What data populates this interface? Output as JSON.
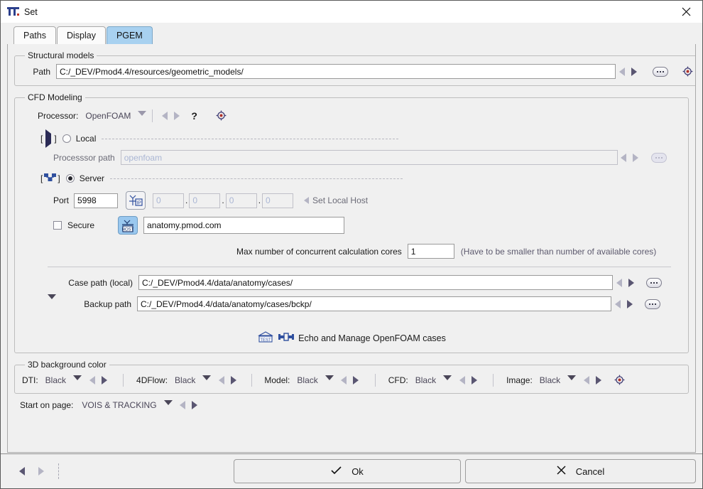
{
  "window": {
    "title": "Set",
    "app_icon": "pmod-logo-icon",
    "close_icon": "close-icon"
  },
  "tabs": [
    {
      "label": "Paths",
      "active": false
    },
    {
      "label": "Display",
      "active": false
    },
    {
      "label": "PGEM",
      "active": true
    }
  ],
  "structural_models": {
    "legend": "Structural models",
    "path_label": "Path",
    "path_value": "C:/_DEV/Pmod4.4/resources/geometric_models/"
  },
  "cfd": {
    "legend": "CFD Modeling",
    "processor_label": "Processor:",
    "processor_value": "OpenFOAM",
    "help_label": "?",
    "local": {
      "label": "Local",
      "selected": false,
      "processor_path_label": "Processsor path",
      "processor_path_value": "",
      "processor_path_placeholder": "openfoam"
    },
    "server": {
      "label": "Server",
      "selected": true,
      "port_label": "Port",
      "port_value": "5998",
      "ip_octets": [
        "0",
        "0",
        "0",
        "0"
      ],
      "set_local_host_label": "Set Local Host",
      "secure_label": "Secure",
      "secure_checked": false,
      "host_value": "anatomy.pmod.com",
      "ip_button_icon": "ip-icon",
      "host_button_icon": "host-icon"
    },
    "cores": {
      "label": "Max number of concurrent calculation cores",
      "value": "1",
      "hint": "(Have to be smaller than number of available cores)"
    },
    "case_path": {
      "label": "Case path (local)",
      "value": "C:/_DEV/Pmod4.4/data/anatomy/cases/"
    },
    "backup_path": {
      "label": "Backup path",
      "value": "C:/_DEV/Pmod4.4/data/anatomy/cases/bckp/"
    },
    "echo": {
      "label": "Echo and Manage OpenFOAM cases",
      "test_icon": "test-icon",
      "link_icon": "connector-icon"
    }
  },
  "background_color": {
    "legend": "3D background color",
    "items": [
      {
        "label": "DTI:",
        "value": "Black"
      },
      {
        "label": "4DFlow:",
        "value": "Black"
      },
      {
        "label": "Model:",
        "value": "Black"
      },
      {
        "label": "CFD:",
        "value": "Black"
      },
      {
        "label": "Image:",
        "value": "Black"
      }
    ]
  },
  "start_on_page": {
    "label": "Start on page:",
    "value": "VOIS & TRACKING"
  },
  "footer": {
    "ok_label": "Ok",
    "cancel_label": "Cancel"
  },
  "colors": {
    "accent_tab": "#a8d1f0",
    "accent_icon_blue": "#9ac8ef",
    "panel_bg": "#f0f0f0",
    "field_bg": "#ffffff"
  }
}
